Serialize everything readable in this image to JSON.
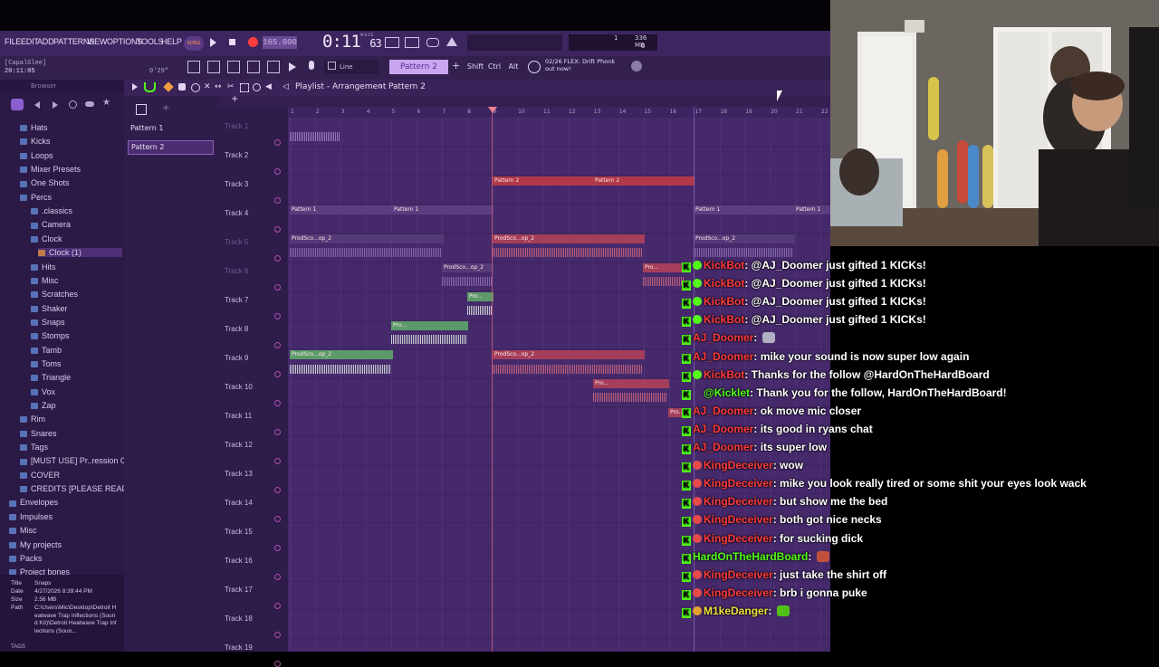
{
  "app": {
    "menu": [
      "FILE",
      "EDIT",
      "ADD",
      "PATTERNS",
      "VIEW",
      "OPTIONS",
      "TOOLS",
      "HELP"
    ],
    "song_mode": "SONG",
    "tempo": "165.000",
    "time": "0:11",
    "time_frac": "63",
    "time_unit": "M:S:CS",
    "cpu": "1",
    "memory": "336 MB",
    "voices": "0",
    "hint_user": "[CapalGlee]",
    "hint_time": "20:11:05",
    "hint_pos": "0'29\"",
    "snap": "Line",
    "pattern_selector": "Pattern 2",
    "keys": [
      "Shift",
      "Ctrl",
      "Alt"
    ],
    "news_line1": "02/26  FLEX: Drift Phonk",
    "news_line2": "out now!"
  },
  "browser": {
    "title": "Browser",
    "items": [
      {
        "label": "Hats",
        "indent": 1
      },
      {
        "label": "Kicks",
        "indent": 1
      },
      {
        "label": "Loops",
        "indent": 1
      },
      {
        "label": "Mixer Presets",
        "indent": 1
      },
      {
        "label": "One Shots",
        "indent": 1
      },
      {
        "label": "Percs",
        "indent": 1
      },
      {
        "label": ".classics",
        "indent": 2
      },
      {
        "label": "Camera",
        "indent": 2
      },
      {
        "label": "Clock",
        "indent": 2
      },
      {
        "label": "Clock (1)",
        "indent": 3
      },
      {
        "label": "Hits",
        "indent": 2
      },
      {
        "label": "Misc",
        "indent": 2
      },
      {
        "label": "Scratches",
        "indent": 2
      },
      {
        "label": "Shaker",
        "indent": 2
      },
      {
        "label": "Snaps",
        "indent": 2
      },
      {
        "label": "Stomps",
        "indent": 2
      },
      {
        "label": "Tamb",
        "indent": 2
      },
      {
        "label": "Toms",
        "indent": 2
      },
      {
        "label": "Triangle",
        "indent": 2
      },
      {
        "label": "Vox",
        "indent": 2
      },
      {
        "label": "Zap",
        "indent": 2
      },
      {
        "label": "Rim",
        "indent": 1
      },
      {
        "label": "Snares",
        "indent": 1
      },
      {
        "label": "Tags",
        "indent": 1
      },
      {
        "label": "[MUST USE] Pr..ression Only",
        "indent": 1
      },
      {
        "label": "COVER",
        "indent": 1
      },
      {
        "label": "CREDITS [PLEASE READ]",
        "indent": 1
      },
      {
        "label": "Envelopes",
        "indent": 0
      },
      {
        "label": "Impulses",
        "indent": 0
      },
      {
        "label": "Misc",
        "indent": 0
      },
      {
        "label": "My projects",
        "indent": 0
      },
      {
        "label": "Packs",
        "indent": 0
      },
      {
        "label": "Project bones",
        "indent": 0
      }
    ],
    "info": {
      "title_label": "Title",
      "title": "Snaps",
      "date_label": "Date",
      "date": "4/27/2026 8:39:44 PM",
      "size_label": "Size",
      "size": "2.56 MB",
      "path_label": "Path",
      "path": "C:\\Users\\Mic\\Desktop\\Detroit Heatwave Trap Inflections (Sound Kit)\\Detroit Heatwave Trap Inflections (Soun..."
    },
    "tags_label": "TAGS"
  },
  "patterns": [
    "Pattern 1",
    "Pattern 2"
  ],
  "playlist": {
    "title": "Playlist - Arrangement",
    "pattern": "Pattern 2",
    "tracks": [
      "Track 1",
      "Track 2",
      "Track 3",
      "Track 4",
      "Track 5",
      "Track 6",
      "Track 7",
      "Track 8",
      "Track 9",
      "Track 10",
      "Track 11",
      "Track 12",
      "Track 13",
      "Track 14",
      "Track 15",
      "Track 16",
      "Track 17",
      "Track 18",
      "Track 19"
    ],
    "bars": [
      "1",
      "2",
      "3",
      "4",
      "5",
      "6",
      "7",
      "8",
      "9",
      "10",
      "11",
      "12",
      "13",
      "14",
      "15",
      "16",
      "17",
      "18",
      "19",
      "20",
      "21",
      "22"
    ],
    "clip_pattern1": "Pattern 1",
    "clip_pattern2": "Pattern 2",
    "clip_prod": "ProdSco...op_2",
    "clip_pro": "Pro..."
  },
  "chat": [
    {
      "user": "KickBot",
      "text": ": @AJ_Doomer just gifted 1 KICKs!"
    },
    {
      "user": "KickBot",
      "text": ": @AJ_Doomer just gifted 1 KICKs!"
    },
    {
      "user": "KickBot",
      "text": ": @AJ_Doomer just gifted 1 KICKs!"
    },
    {
      "user": "KickBot",
      "text": ": @AJ_Doomer just gifted 1 KICKs!"
    },
    {
      "user": "AJ_Doomer",
      "text": ":"
    },
    {
      "user": "AJ_Doomer",
      "text": ": mike your sound is now super low again"
    },
    {
      "user": "KickBot",
      "text": ": Thanks for the follow @HardOnTheHardBoard"
    },
    {
      "user": "@Kicklet",
      "text": ": Thank you for the follow, HardOnTheHardBoard!"
    },
    {
      "user": "AJ_Doomer",
      "text": ": ok move mic closer"
    },
    {
      "user": "AJ_Doomer",
      "text": ": its good in ryans chat"
    },
    {
      "user": "AJ_Doomer",
      "text": ": its super low"
    },
    {
      "user": "KingDeceiver",
      "text": ": wow"
    },
    {
      "user": "KingDeceiver",
      "text": ": mike you look really tired or some shit your eyes look wack"
    },
    {
      "user": "KingDeceiver",
      "text": ": but show me the bed"
    },
    {
      "user": "KingDeceiver",
      "text": ": both got nice necks"
    },
    {
      "user": "KingDeceiver",
      "text": ": for sucking dick"
    },
    {
      "user": "HardOnTheHardBoard",
      "text": ":"
    },
    {
      "user": "KingDeceiver",
      "text": ": just take the shirt off"
    },
    {
      "user": "KingDeceiver",
      "text": ": brb i gonna puke"
    },
    {
      "user": "M1keDanger",
      "text": ":"
    }
  ],
  "colors": {
    "kick_green": "#53fc18",
    "fl_purple": "#45296b",
    "clip_red": "#c23a4a"
  }
}
